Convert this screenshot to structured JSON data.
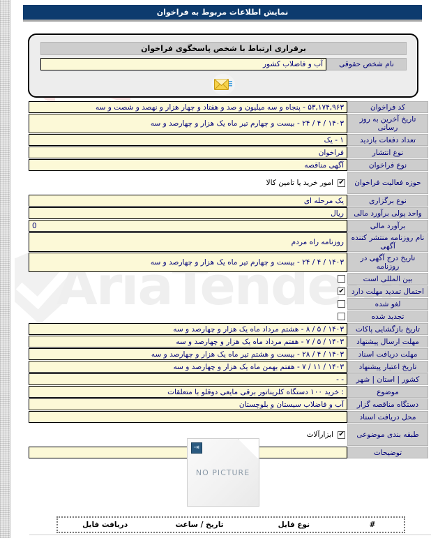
{
  "header": {
    "title": "نمایش اطلاعات مربوط به فراخوان"
  },
  "contact": {
    "section_title": "برقراری ارتباط با شخص پاسخگوی فراخوان",
    "legal_person_label": "نام شخص حقوقی",
    "legal_person_value": "آب و فاضلاب کشور",
    "mail_icon": "envelope-icon"
  },
  "rows": [
    {
      "label": "کد فراخوان",
      "value": "۵۳,۱۷۴,۹۶۳ - پنجاه و سه میلیون و صد و هفتاد و چهار هزار و نهصد و شصت و سه",
      "type": "field"
    },
    {
      "label": "تاریخ آخرین به روز رسانی",
      "value": "۱۴۰۳ / ۴ / ۲۴ - بیست و چهارم تیر ماه یک هزار و چهارصد و سه",
      "type": "field"
    },
    {
      "label": "تعداد دفعات بازدید",
      "value": "۱ - یک",
      "type": "field"
    },
    {
      "label": "نوع انتشار",
      "value": "فراخوان",
      "type": "field"
    },
    {
      "label": "نوع فراخوان",
      "value": "آگهی مناقصه",
      "type": "field"
    },
    {
      "label": "حوزه فعالیت فراخوان",
      "value": "امور خرید یا تامین کالا",
      "type": "checkbox",
      "checked": true
    },
    {
      "label": "نوع برگزاری",
      "value": "یک مرحله ای",
      "type": "field"
    },
    {
      "label": "واحد پولی برآورد مالی",
      "value": "ریال",
      "type": "field"
    },
    {
      "label": "برآورد مالی",
      "value": "0",
      "type": "field-ltr"
    },
    {
      "label": "نام روزنامه منتشر کننده آگهی",
      "value": "روزنامه راه مردم",
      "type": "field"
    },
    {
      "label": "تاریخ درج آگهی در روزنامه",
      "value": "۱۴۰۳ / ۴ / ۲۴ - بیست و چهارم تیر ماه یک هزار و چهارصد و سه",
      "type": "field"
    },
    {
      "label": "بین المللی است",
      "value": "",
      "type": "checkbox",
      "checked": false
    },
    {
      "label": "احتمال تمدید مهلت دارد",
      "value": "",
      "type": "checkbox",
      "checked": true
    },
    {
      "label": "لغو شده",
      "value": "",
      "type": "checkbox",
      "checked": false
    },
    {
      "label": "تجدید شده",
      "value": "",
      "type": "checkbox",
      "checked": false
    },
    {
      "label": "تاریخ بازگشایی پاکات",
      "value": "۱۴۰۳ / ۵ / ۸ - هشتم مرداد ماه یک هزار و چهارصد و سه",
      "type": "field"
    },
    {
      "label": "مهلت ارسال پیشنهاد",
      "value": "۱۴۰۳ / ۵ / ۷ - هفتم مرداد ماه یک هزار و چهارصد و سه",
      "type": "field"
    },
    {
      "label": "مهلت دریافت اسناد",
      "value": "۱۴۰۳ / ۴ / ۲۸ - بیست و هشتم تیر ماه یک هزار و چهارصد و سه",
      "type": "field"
    },
    {
      "label": "تاریخ اعتبار پیشنهاد",
      "value": "۱۴۰۳ / ۱۱ / ۷ - هفتم بهمن ماه یک هزار و چهارصد و سه",
      "type": "field"
    },
    {
      "label": "کشور | استان | شهر",
      "value": "- -",
      "type": "field"
    },
    {
      "label": "موضوع",
      "value": ": خرید ۱۰۰ دستگاه کلریناتور برقی مایعی دوقلو با متعلقات",
      "type": "field"
    },
    {
      "label": "دستگاه مناقصه گزار",
      "value": "آب و فاضلاب سیستان و بلوچستان",
      "type": "field"
    },
    {
      "label": "محل دریافت اسناد",
      "value": "",
      "type": "field"
    },
    {
      "label": "طبقه بندی موضوعی",
      "value": "ابزارآلات",
      "type": "checkbox",
      "checked": true
    },
    {
      "label": "توضیحات",
      "value": "",
      "type": "field"
    }
  ],
  "preview": {
    "no_picture_text": "NO PICTURE",
    "broken_image_icon": "broken-image-icon"
  },
  "file_table": {
    "columns": [
      "#",
      "نوع فایل",
      "تاریخ / ساعت",
      "دریافت فایل"
    ]
  },
  "watermark": {
    "text": "AriaTender.ir",
    "shield_icon": "shield-check-icon"
  },
  "colors": {
    "title_bar": "#0d3b6e",
    "label_bg": "#cdcdcd",
    "value_bg": "#fcf9d7",
    "value_text": "#00007a"
  }
}
